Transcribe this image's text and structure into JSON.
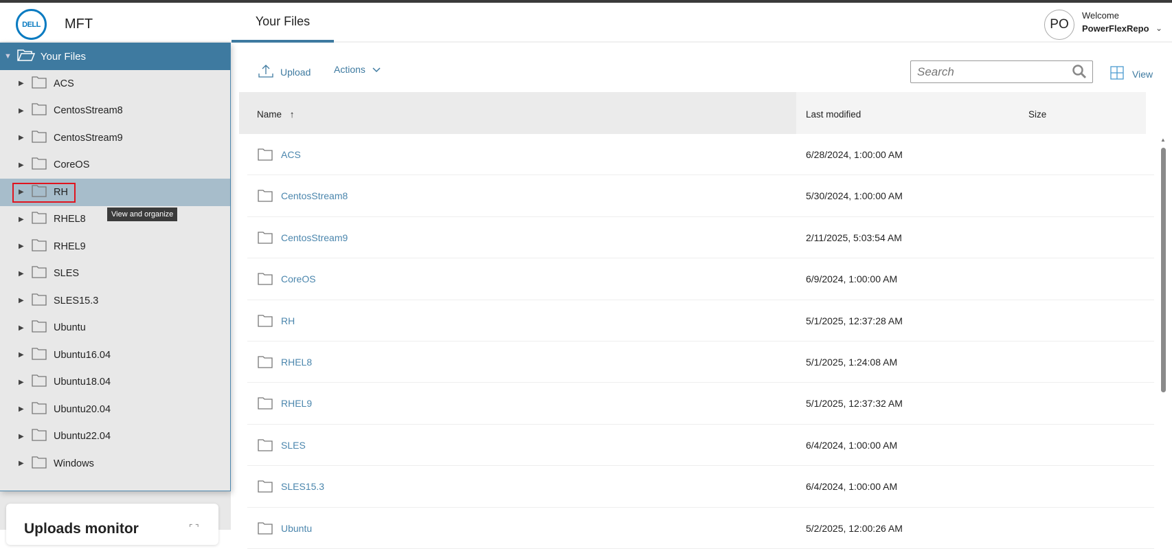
{
  "header": {
    "logo": "DELL",
    "app": "MFT",
    "tab": "Your Files",
    "avatar": "PO",
    "welcome": "Welcome",
    "user": "PowerFlexRepo"
  },
  "sidebar": {
    "root": "Your Files",
    "items": [
      "ACS",
      "CentosStream8",
      "CentosStream9",
      "CoreOS",
      "RH",
      "RHEL8",
      "RHEL9",
      "SLES",
      "SLES15.3",
      "Ubuntu",
      "Ubuntu16.04",
      "Ubuntu18.04",
      "Ubuntu20.04",
      "Ubuntu22.04",
      "Windows"
    ],
    "selected": "RH",
    "tooltip": "View and organize"
  },
  "uploads_monitor": {
    "title": "Uploads monitor"
  },
  "toolbar": {
    "upload": "Upload",
    "actions": "Actions",
    "search_placeholder": "Search",
    "view": "View"
  },
  "table": {
    "columns": {
      "name": "Name",
      "modified": "Last modified",
      "size": "Size"
    },
    "rows": [
      {
        "name": "ACS",
        "modified": "6/28/2024, 1:00:00 AM"
      },
      {
        "name": "CentosStream8",
        "modified": "5/30/2024, 1:00:00 AM"
      },
      {
        "name": "CentosStream9",
        "modified": "2/11/2025, 5:03:54 AM"
      },
      {
        "name": "CoreOS",
        "modified": "6/9/2024, 1:00:00 AM"
      },
      {
        "name": "RH",
        "modified": "5/1/2025, 12:37:28 AM"
      },
      {
        "name": "RHEL8",
        "modified": "5/1/2025, 1:24:08 AM"
      },
      {
        "name": "RHEL9",
        "modified": "5/1/2025, 12:37:32 AM"
      },
      {
        "name": "SLES",
        "modified": "6/4/2024, 1:00:00 AM"
      },
      {
        "name": "SLES15.3",
        "modified": "6/4/2024, 1:00:00 AM"
      },
      {
        "name": "Ubuntu",
        "modified": "5/2/2025, 12:00:26 AM"
      }
    ]
  },
  "colors": {
    "accent": "#3e7aa0",
    "link": "#4b86ad",
    "selected": "#a7bdcb",
    "highlight": "#e0141e"
  }
}
